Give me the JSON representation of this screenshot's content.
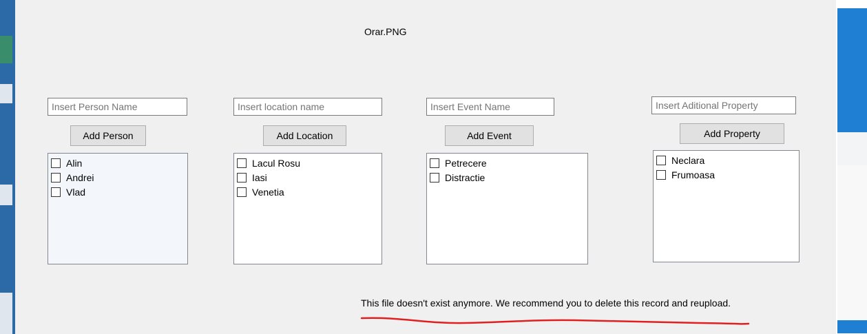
{
  "window": {
    "title": "Orar.PNG"
  },
  "person": {
    "placeholder": "Insert Person Name",
    "button": "Add Person",
    "items": [
      "Alin",
      "Andrei",
      "Vlad"
    ]
  },
  "location": {
    "placeholder": "Insert location name",
    "button": "Add Location",
    "items": [
      "Lacul Rosu",
      "Iasi",
      "Venetia"
    ]
  },
  "event": {
    "placeholder": "Insert Event Name",
    "button": "Add Event",
    "items": [
      "Petrecere",
      "Distractie"
    ]
  },
  "property": {
    "placeholder": "Insert Aditional Property",
    "button": "Add Property",
    "items": [
      "Neclara",
      "Frumoasa"
    ]
  },
  "message": "This file doesn't exist anymore. We recommend you to delete this record and reupload.",
  "colors": {
    "annotation": "#e02020",
    "desktop_accent": "#1f7fd2"
  }
}
